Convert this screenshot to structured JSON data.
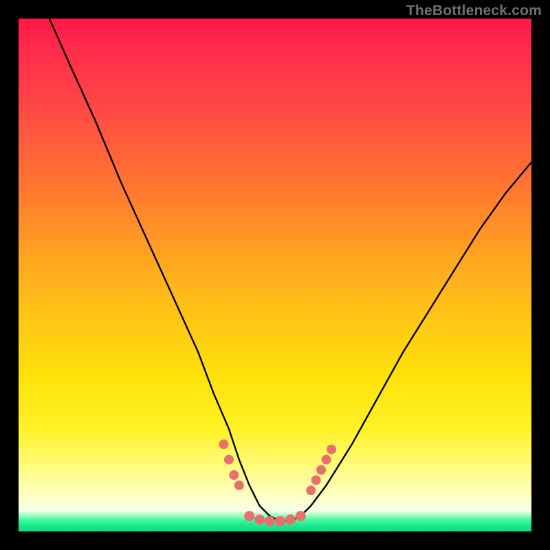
{
  "watermark": "TheBottleneck.com",
  "chart_data": {
    "type": "line",
    "title": "",
    "xlabel": "",
    "ylabel": "",
    "xlim": [
      0,
      100
    ],
    "ylim": [
      0,
      100
    ],
    "grid": false,
    "legend": false,
    "background_gradient": {
      "stops": [
        {
          "pos": 0.0,
          "color": "#ff1745"
        },
        {
          "pos": 0.18,
          "color": "#ff4a44"
        },
        {
          "pos": 0.46,
          "color": "#ffa321"
        },
        {
          "pos": 0.7,
          "color": "#ffe20a"
        },
        {
          "pos": 0.88,
          "color": "#fffc84"
        },
        {
          "pos": 0.97,
          "color": "#7bffb0"
        },
        {
          "pos": 1.0,
          "color": "#13dd87"
        }
      ]
    },
    "series": [
      {
        "name": "bottleneck-curve",
        "color": "#000000",
        "x": [
          6,
          10,
          15,
          20,
          25,
          30,
          35,
          38,
          41,
          43,
          45,
          47,
          49,
          51,
          53,
          55,
          57,
          60,
          65,
          70,
          75,
          80,
          85,
          90,
          95,
          100
        ],
        "y": [
          100,
          91,
          80,
          68,
          57,
          46,
          35,
          27,
          20,
          14,
          9,
          5,
          3,
          2,
          2,
          3,
          5,
          9,
          17,
          26,
          35,
          43,
          51,
          59,
          66,
          72
        ]
      }
    ],
    "annotations": {
      "left_dense_dots": {
        "color": "#e96f6d",
        "x": [
          40,
          41,
          42,
          43
        ],
        "y": [
          17,
          14,
          11,
          9
        ]
      },
      "right_dense_dots": {
        "color": "#e96f6d",
        "x": [
          57,
          58,
          59,
          60,
          61
        ],
        "y": [
          8,
          10,
          12,
          14,
          16
        ]
      },
      "bottom_dots": {
        "color": "#e96f6d",
        "x": [
          45,
          47,
          49,
          51,
          53,
          55
        ],
        "y": [
          3,
          2.3,
          2,
          2,
          2.3,
          3
        ]
      }
    }
  }
}
